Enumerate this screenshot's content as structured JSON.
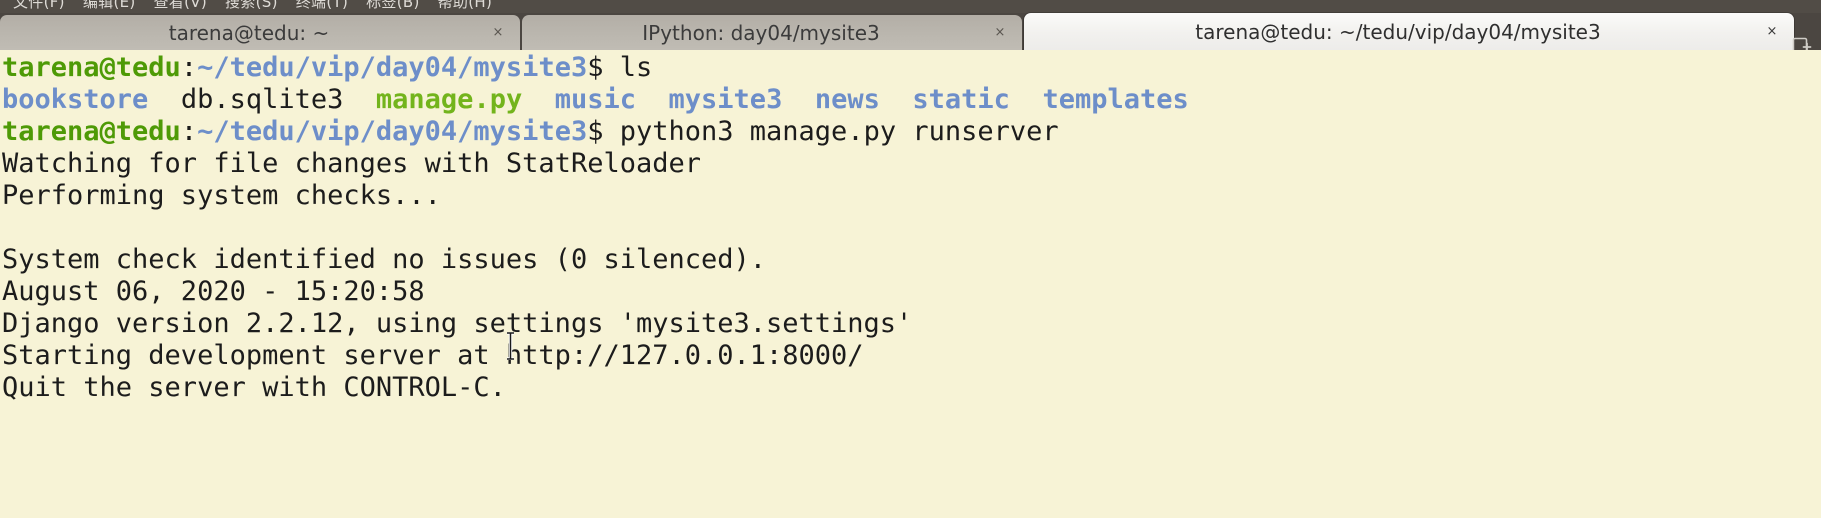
{
  "window": {
    "app": "GNOME Terminal",
    "background_color": "#f7f3d6",
    "tabbar_color": "#4b4641"
  },
  "menubar": {
    "items": [
      {
        "label": "文件(F)"
      },
      {
        "label": "编辑(E)"
      },
      {
        "label": "查看(V)"
      },
      {
        "label": "搜索(S)"
      },
      {
        "label": "终端(T)"
      },
      {
        "label": "标签(B)"
      },
      {
        "label": "帮助(H)"
      }
    ]
  },
  "tabbar": {
    "tabs": [
      {
        "label": "tarena@tedu: ~",
        "close": "×",
        "active": false
      },
      {
        "label": "IPython: day04/mysite3",
        "close": "×",
        "active": false
      },
      {
        "label": "tarena@tedu: ~/tedu/vip/day04/mysite3",
        "close": "×",
        "active": true
      }
    ],
    "new_tab_icon": "new-tab-icon"
  },
  "terminal": {
    "prompt": {
      "user_host": "tarena@tedu",
      "colon": ":",
      "path": "~/tedu/vip/day04/mysite3",
      "sigil": "$"
    },
    "commands": {
      "ls": " ls",
      "runserver": " python3 manage.py runserver"
    },
    "ls_output": [
      {
        "name": "bookstore",
        "type": "dir"
      },
      {
        "name": "db.sqlite3",
        "type": "file"
      },
      {
        "name": "manage.py",
        "type": "exec"
      },
      {
        "name": "music",
        "type": "dir"
      },
      {
        "name": "mysite3",
        "type": "dir"
      },
      {
        "name": "news",
        "type": "dir"
      },
      {
        "name": "static",
        "type": "dir"
      },
      {
        "name": "templates",
        "type": "dir"
      }
    ],
    "ls_line": "bookstore  db.sqlite3  manage.py  music  mysite3  news  static  templates",
    "output_lines": [
      "Watching for file changes with StatReloader",
      "Performing system checks...",
      "",
      "System check identified no issues (0 silenced).",
      "August 06, 2020 - 15:20:58",
      "Django version 2.2.12, using settings 'mysite3.settings'",
      "Starting development server at http://127.0.0.1:8000/",
      "Quit the server with CONTROL-C."
    ],
    "colors": {
      "directory": "#6d8ec9",
      "executable": "#73b41c",
      "user": "#4e9a06",
      "path": "#6d8ec9",
      "foreground": "#1c1c1c",
      "background": "#f7f3d6"
    }
  }
}
